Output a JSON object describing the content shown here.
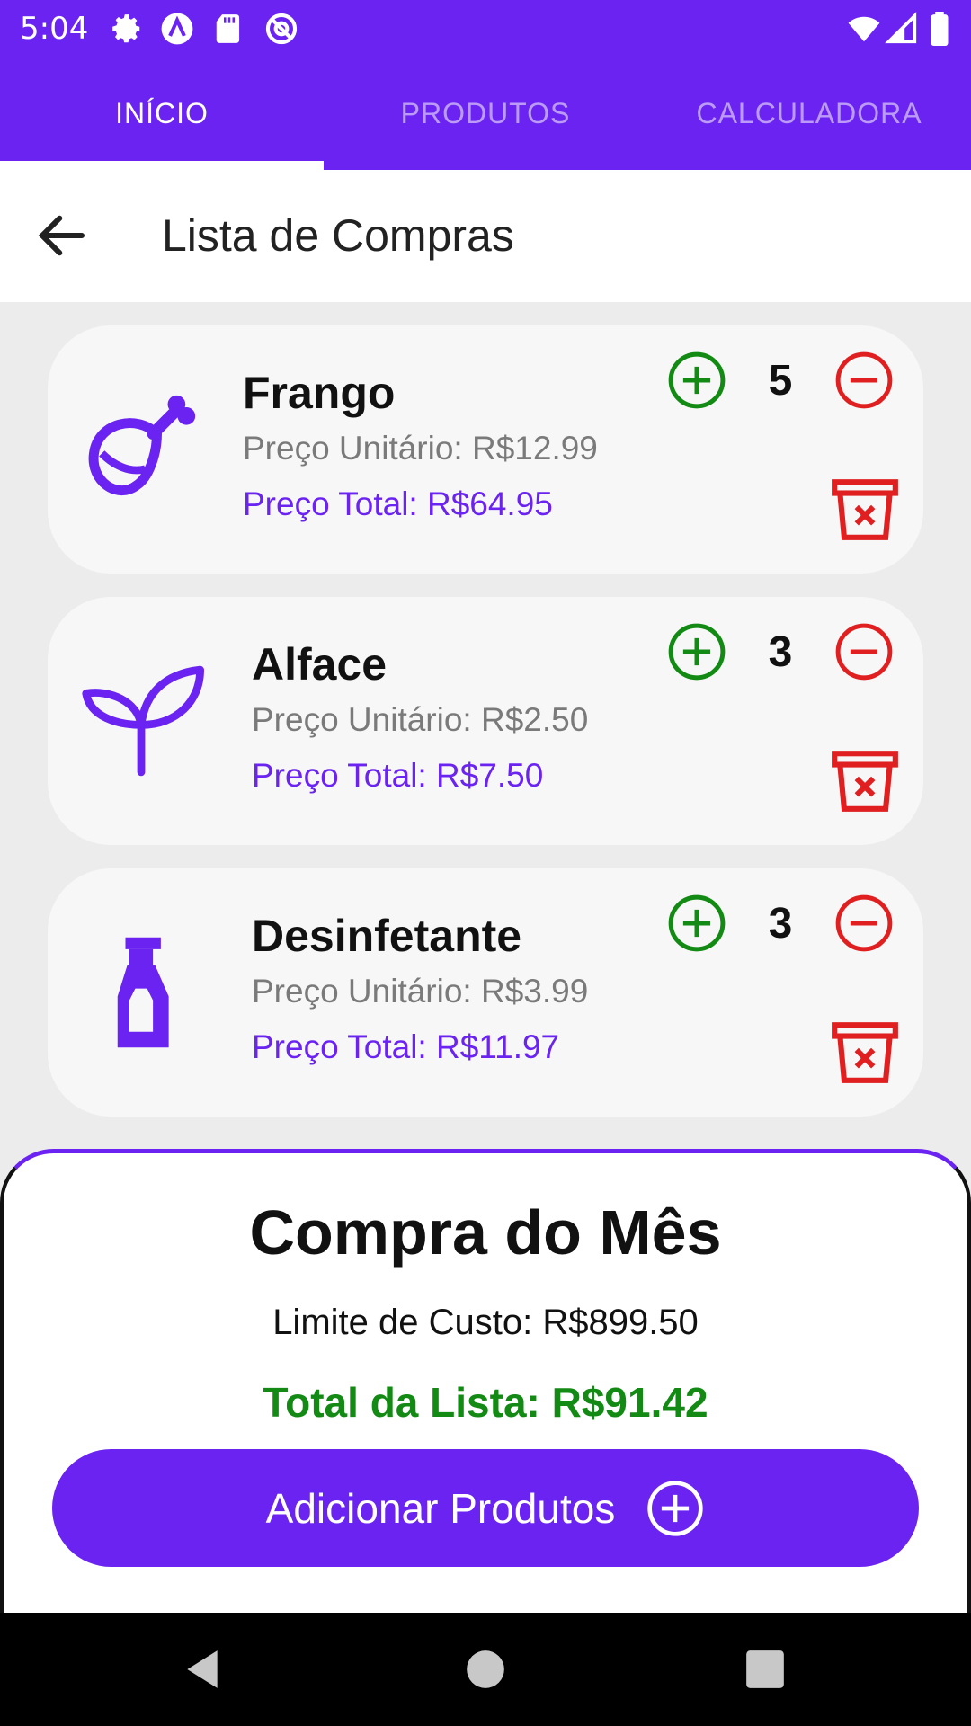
{
  "status_bar": {
    "time": "5:04",
    "left_icons": [
      "gear-icon",
      "app-a-icon",
      "sd-card-icon",
      "at-circle-icon"
    ],
    "right_icons": [
      "wifi-icon",
      "signal-icon",
      "battery-icon"
    ]
  },
  "tabs": [
    {
      "label": "INÍCIO",
      "active": true
    },
    {
      "label": "PRODUTOS",
      "active": false
    },
    {
      "label": "CALCULADORA",
      "active": false
    }
  ],
  "header": {
    "back_icon": "arrow-left-icon",
    "title": "Lista de Compras"
  },
  "products": [
    {
      "name": "Frango",
      "unit_price": "Preço Unitário: R$12.99",
      "total_price": "Preço Total: R$64.95",
      "quantity": "5",
      "icon": "chicken-leg-icon"
    },
    {
      "name": "Alface",
      "unit_price": "Preço Unitário: R$2.50",
      "total_price": "Preço Total: R$7.50",
      "quantity": "3",
      "icon": "sprout-icon"
    },
    {
      "name": "Desinfetante",
      "unit_price": "Preço Unitário: R$3.99",
      "total_price": "Preço Total: R$11.97",
      "quantity": "3",
      "icon": "spray-bottle-icon"
    }
  ],
  "summary": {
    "title": "Compra do Mês",
    "limit": "Limite de Custo: R$899.50",
    "total": "Total da Lista: R$91.42",
    "add_button": "Adicionar Produtos"
  },
  "colors": {
    "primary": "#6a23f0",
    "plus": "#138a14",
    "minus": "#e02020",
    "total_green": "#138a14"
  },
  "nav_bar": [
    "back-triangle-icon",
    "home-circle-icon",
    "recents-square-icon"
  ]
}
